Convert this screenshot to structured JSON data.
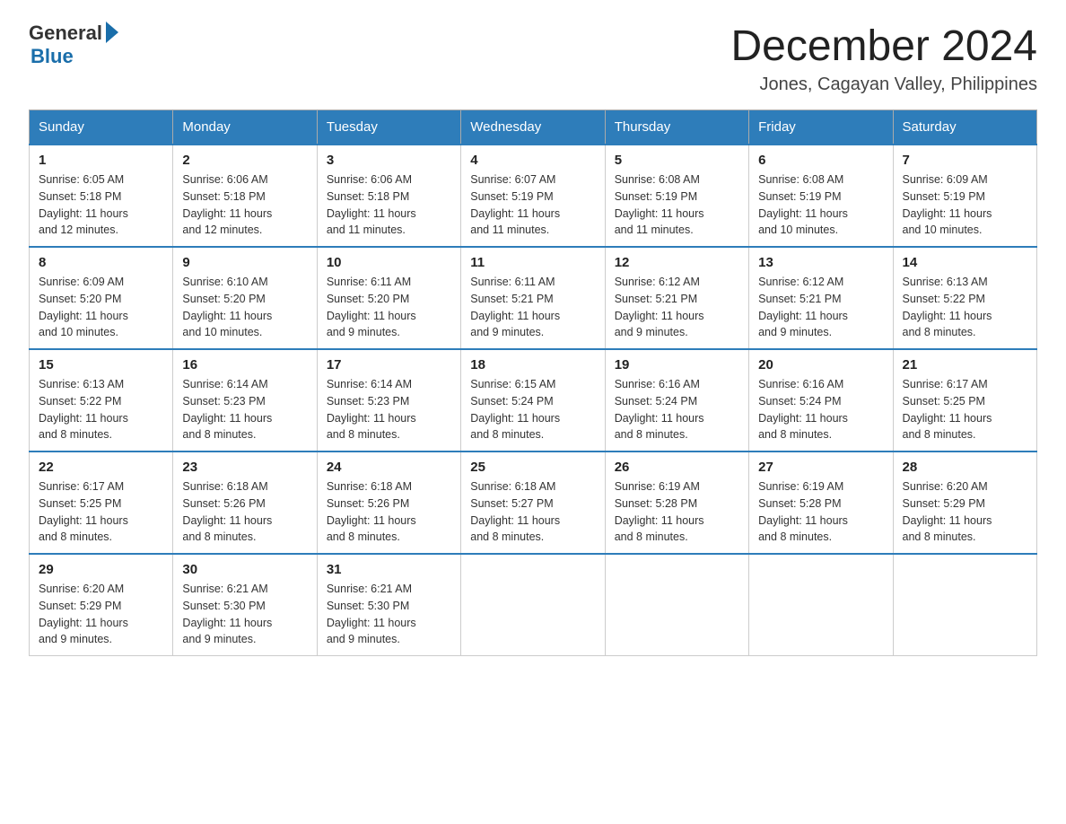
{
  "header": {
    "logo_general": "General",
    "logo_blue": "Blue",
    "month_title": "December 2024",
    "location": "Jones, Cagayan Valley, Philippines"
  },
  "days_of_week": [
    "Sunday",
    "Monday",
    "Tuesday",
    "Wednesday",
    "Thursday",
    "Friday",
    "Saturday"
  ],
  "weeks": [
    [
      {
        "day": "1",
        "sunrise": "6:05 AM",
        "sunset": "5:18 PM",
        "daylight": "11 hours and 12 minutes."
      },
      {
        "day": "2",
        "sunrise": "6:06 AM",
        "sunset": "5:18 PM",
        "daylight": "11 hours and 12 minutes."
      },
      {
        "day": "3",
        "sunrise": "6:06 AM",
        "sunset": "5:18 PM",
        "daylight": "11 hours and 11 minutes."
      },
      {
        "day": "4",
        "sunrise": "6:07 AM",
        "sunset": "5:19 PM",
        "daylight": "11 hours and 11 minutes."
      },
      {
        "day": "5",
        "sunrise": "6:08 AM",
        "sunset": "5:19 PM",
        "daylight": "11 hours and 11 minutes."
      },
      {
        "day": "6",
        "sunrise": "6:08 AM",
        "sunset": "5:19 PM",
        "daylight": "11 hours and 10 minutes."
      },
      {
        "day": "7",
        "sunrise": "6:09 AM",
        "sunset": "5:19 PM",
        "daylight": "11 hours and 10 minutes."
      }
    ],
    [
      {
        "day": "8",
        "sunrise": "6:09 AM",
        "sunset": "5:20 PM",
        "daylight": "11 hours and 10 minutes."
      },
      {
        "day": "9",
        "sunrise": "6:10 AM",
        "sunset": "5:20 PM",
        "daylight": "11 hours and 10 minutes."
      },
      {
        "day": "10",
        "sunrise": "6:11 AM",
        "sunset": "5:20 PM",
        "daylight": "11 hours and 9 minutes."
      },
      {
        "day": "11",
        "sunrise": "6:11 AM",
        "sunset": "5:21 PM",
        "daylight": "11 hours and 9 minutes."
      },
      {
        "day": "12",
        "sunrise": "6:12 AM",
        "sunset": "5:21 PM",
        "daylight": "11 hours and 9 minutes."
      },
      {
        "day": "13",
        "sunrise": "6:12 AM",
        "sunset": "5:21 PM",
        "daylight": "11 hours and 9 minutes."
      },
      {
        "day": "14",
        "sunrise": "6:13 AM",
        "sunset": "5:22 PM",
        "daylight": "11 hours and 8 minutes."
      }
    ],
    [
      {
        "day": "15",
        "sunrise": "6:13 AM",
        "sunset": "5:22 PM",
        "daylight": "11 hours and 8 minutes."
      },
      {
        "day": "16",
        "sunrise": "6:14 AM",
        "sunset": "5:23 PM",
        "daylight": "11 hours and 8 minutes."
      },
      {
        "day": "17",
        "sunrise": "6:14 AM",
        "sunset": "5:23 PM",
        "daylight": "11 hours and 8 minutes."
      },
      {
        "day": "18",
        "sunrise": "6:15 AM",
        "sunset": "5:24 PM",
        "daylight": "11 hours and 8 minutes."
      },
      {
        "day": "19",
        "sunrise": "6:16 AM",
        "sunset": "5:24 PM",
        "daylight": "11 hours and 8 minutes."
      },
      {
        "day": "20",
        "sunrise": "6:16 AM",
        "sunset": "5:24 PM",
        "daylight": "11 hours and 8 minutes."
      },
      {
        "day": "21",
        "sunrise": "6:17 AM",
        "sunset": "5:25 PM",
        "daylight": "11 hours and 8 minutes."
      }
    ],
    [
      {
        "day": "22",
        "sunrise": "6:17 AM",
        "sunset": "5:25 PM",
        "daylight": "11 hours and 8 minutes."
      },
      {
        "day": "23",
        "sunrise": "6:18 AM",
        "sunset": "5:26 PM",
        "daylight": "11 hours and 8 minutes."
      },
      {
        "day": "24",
        "sunrise": "6:18 AM",
        "sunset": "5:26 PM",
        "daylight": "11 hours and 8 minutes."
      },
      {
        "day": "25",
        "sunrise": "6:18 AM",
        "sunset": "5:27 PM",
        "daylight": "11 hours and 8 minutes."
      },
      {
        "day": "26",
        "sunrise": "6:19 AM",
        "sunset": "5:28 PM",
        "daylight": "11 hours and 8 minutes."
      },
      {
        "day": "27",
        "sunrise": "6:19 AM",
        "sunset": "5:28 PM",
        "daylight": "11 hours and 8 minutes."
      },
      {
        "day": "28",
        "sunrise": "6:20 AM",
        "sunset": "5:29 PM",
        "daylight": "11 hours and 8 minutes."
      }
    ],
    [
      {
        "day": "29",
        "sunrise": "6:20 AM",
        "sunset": "5:29 PM",
        "daylight": "11 hours and 9 minutes."
      },
      {
        "day": "30",
        "sunrise": "6:21 AM",
        "sunset": "5:30 PM",
        "daylight": "11 hours and 9 minutes."
      },
      {
        "day": "31",
        "sunrise": "6:21 AM",
        "sunset": "5:30 PM",
        "daylight": "11 hours and 9 minutes."
      },
      null,
      null,
      null,
      null
    ]
  ],
  "labels": {
    "sunrise": "Sunrise:",
    "sunset": "Sunset:",
    "daylight": "Daylight:"
  }
}
